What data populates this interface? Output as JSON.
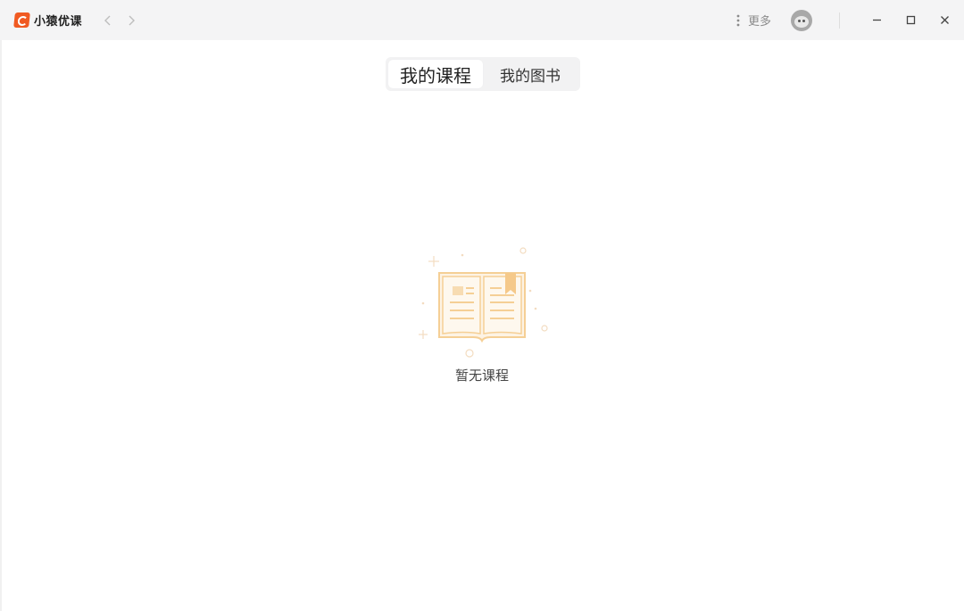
{
  "app": {
    "title": "小猿优课",
    "accent_color": "#f05a22"
  },
  "header": {
    "more_label": "更多",
    "icons": [
      "back-icon",
      "forward-icon",
      "more-vertical-icon",
      "avatar",
      "minimize-icon",
      "maximize-icon",
      "close-icon"
    ]
  },
  "tabs": [
    {
      "label": "我的课程",
      "active": true
    },
    {
      "label": "我的图书",
      "active": false
    }
  ],
  "empty_state": {
    "message": "暂无课程",
    "illustration": "open-book-icon",
    "illustration_color": "#f7d9a8"
  }
}
